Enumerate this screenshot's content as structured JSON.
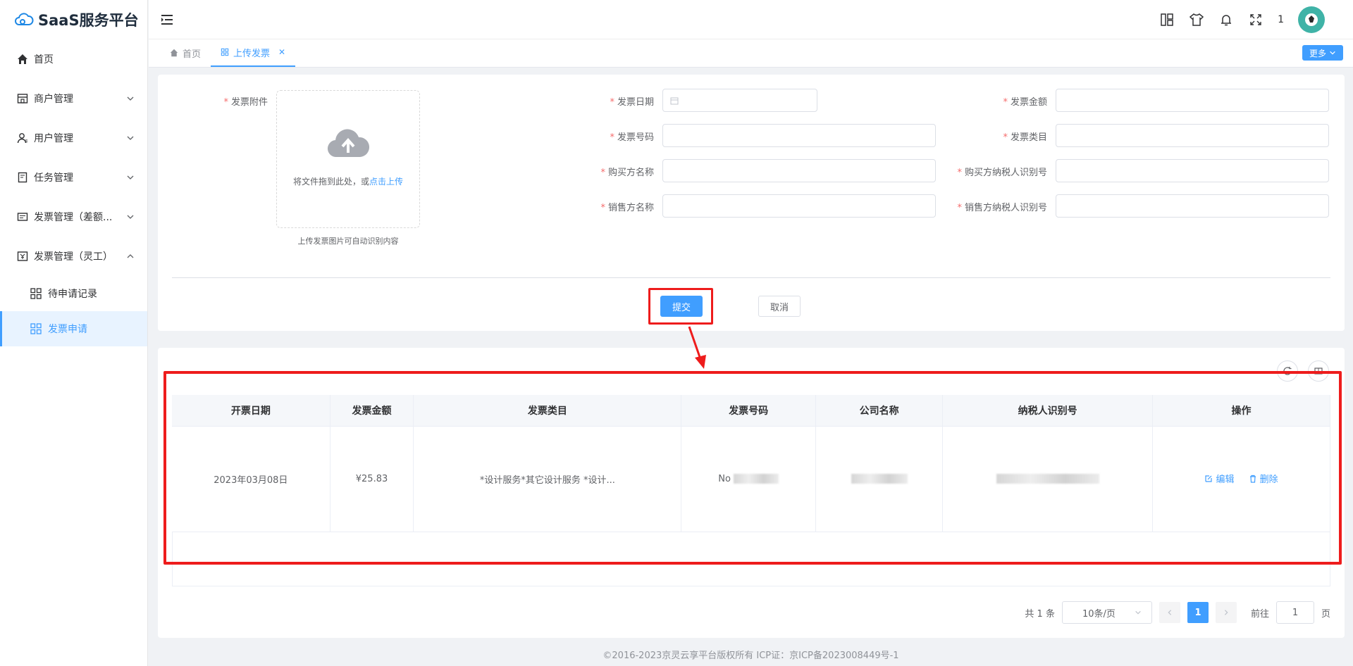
{
  "app": {
    "title": "SaaS服务平台"
  },
  "sidebar": {
    "items": [
      {
        "label": "首页",
        "icon": "home-icon"
      },
      {
        "label": "商户管理",
        "icon": "shop-icon"
      },
      {
        "label": "用户管理",
        "icon": "user-icon"
      },
      {
        "label": "任务管理",
        "icon": "task-icon"
      },
      {
        "label": "发票管理（差额..."
      },
      {
        "label": "发票管理（灵工）"
      }
    ],
    "sub_items": [
      {
        "label": "待申请记录"
      },
      {
        "label": "发票申请"
      }
    ]
  },
  "header": {
    "notification_count": "1"
  },
  "tabs": [
    {
      "label": "首页"
    },
    {
      "label": "上传发票"
    }
  ],
  "more_button": "更多",
  "form": {
    "attachment_label": "发票附件",
    "upload_text": "将文件拖到此处，或",
    "upload_link": "点击上传",
    "upload_tip": "上传发票图片可自动识别内容",
    "invoice_date_label": "发票日期",
    "invoice_amount_label": "发票金额",
    "invoice_number_label": "发票号码",
    "invoice_category_label": "发票类目",
    "buyer_name_label": "购买方名称",
    "buyer_tax_label": "购买方纳税人识别号",
    "seller_name_label": "销售方名称",
    "seller_tax_label": "销售方纳税人识别号",
    "submit": "提交",
    "cancel": "取消"
  },
  "table": {
    "headers": [
      "开票日期",
      "发票金额",
      "发票类目",
      "发票号码",
      "公司名称",
      "纳税人识别号",
      "操作"
    ],
    "row": {
      "date": "2023年03月08日",
      "amount": "¥25.83",
      "category": "*设计服务*其它设计服务 *设计...",
      "number_prefix": "No"
    },
    "edit": "编辑",
    "delete": "删除"
  },
  "pagination": {
    "total": "共 1 条",
    "page_size": "10条/页",
    "current_page": "1",
    "goto_label": "前往",
    "goto_value": "1",
    "page_suffix": "页"
  },
  "footer": "©2016-2023京灵云享平台版权所有 ICP证：京ICP备2023008449号-1",
  "colors": {
    "primary": "#409eff",
    "annotation": "#ee1c1c",
    "required": "#f56c6c"
  }
}
